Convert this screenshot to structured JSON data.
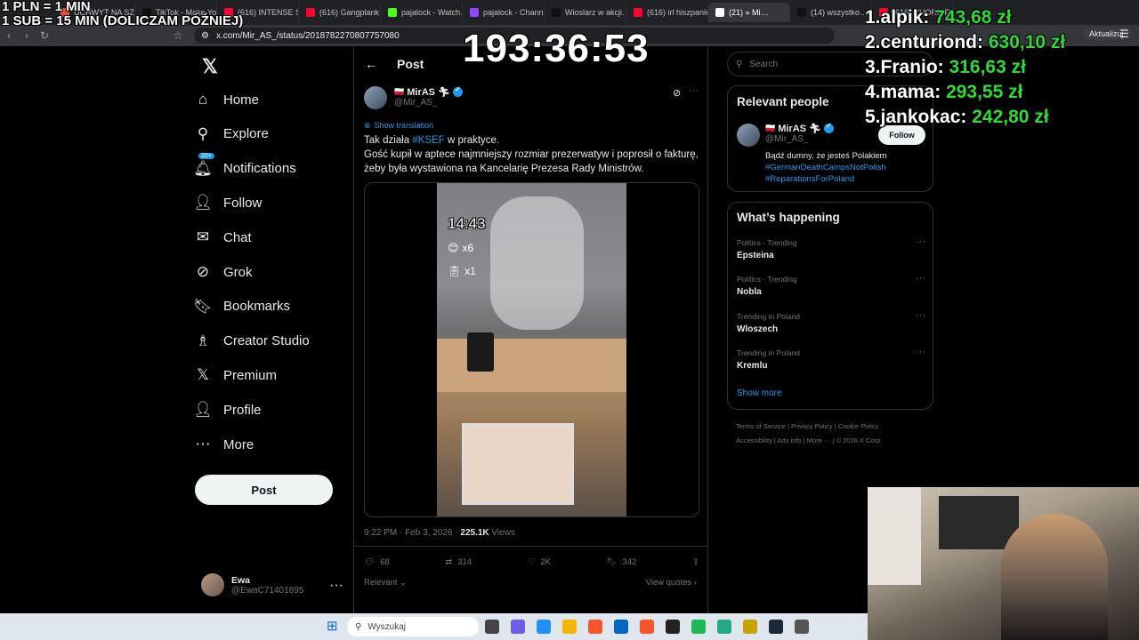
{
  "overlay": {
    "pln_line1": "1 PLN = 1 MIN",
    "pln_line2": "1 SUB = 15 MIN (DOLICZAM PÓŹNIEJ)",
    "timer": "193:36:53",
    "leaderboard": [
      {
        "rank": "1.",
        "name": "alpik:",
        "amount": "743,68 zł"
      },
      {
        "rank": "2.",
        "name": "centuriond:",
        "amount": "630,10 zł"
      },
      {
        "rank": "3.",
        "name": "Franio:",
        "amount": "316,63 zł"
      },
      {
        "rank": "4.",
        "name": "mama:",
        "amount": "293,55 zł"
      },
      {
        "rank": "5.",
        "name": "jankokac:",
        "amount": "242,80 zł"
      }
    ]
  },
  "browser": {
    "tabs": [
      {
        "label": "UCHWYT NA SZ…",
        "color": "#e44d26"
      },
      {
        "label": "TikTok - Make Yo…",
        "color": "#111111"
      },
      {
        "label": "(616) INTENSE S…",
        "color": "#ff0033"
      },
      {
        "label": "(616) Gangplank…",
        "color": "#ff0033"
      },
      {
        "label": "pajalock - Watch…",
        "color": "#53fc18"
      },
      {
        "label": "pajalock - Chann…",
        "color": "#9146ff"
      },
      {
        "label": "Wioslarz w akcji…",
        "color": "#111111"
      },
      {
        "label": "(616) irl hiszpanie…",
        "color": "#ff0033"
      },
      {
        "label": "(21) » Mi…",
        "color": "#ffffff",
        "active": true
      },
      {
        "label": "(14) wszystko…",
        "color": "#111111"
      },
      {
        "label": "(616) CHORE P…",
        "color": "#ff0033"
      }
    ],
    "url": "x.com/Mir_AS_/status/2018782270807757080",
    "update_button": "Aktualizuj"
  },
  "nav": {
    "items": [
      {
        "label": "Home",
        "icon": "home-icon",
        "glyph": "⌂"
      },
      {
        "label": "Explore",
        "icon": "search-icon",
        "glyph": "⚲"
      },
      {
        "label": "Notifications",
        "icon": "bell-icon",
        "glyph": "🔔︎"
      },
      {
        "label": "Follow",
        "icon": "add-person-icon",
        "glyph": "👤︎"
      },
      {
        "label": "Chat",
        "icon": "mail-icon",
        "glyph": "✉"
      },
      {
        "label": "Grok",
        "icon": "grok-icon",
        "glyph": "⊘"
      },
      {
        "label": "Bookmarks",
        "icon": "bookmark-icon",
        "glyph": "🔖︎"
      },
      {
        "label": "Creator Studio",
        "icon": "creator-studio-icon",
        "glyph": "♗"
      },
      {
        "label": "Premium",
        "icon": "x-logo-icon",
        "glyph": "𝕏"
      },
      {
        "label": "Profile",
        "icon": "profile-icon",
        "glyph": "👤︎"
      },
      {
        "label": "More",
        "icon": "more-circle-icon",
        "glyph": "⋯"
      }
    ],
    "notifications_badge": "20+",
    "post_button": "Post",
    "user": {
      "name": "Ewa",
      "handle": "@EwaC71401895"
    }
  },
  "post": {
    "header": "Post",
    "author_name": "MirAS",
    "author_handle": "@Mir_AS_",
    "show_translation": "Show translation",
    "text_before_tag": "Tak działa ",
    "hashtag": "#KSEF",
    "text_after_tag": " w praktyce.",
    "text_line2": "Gość kupił w aptece najmniejszy rozmiar prezerwatyw i poprosił o fakturę, żeby była wystawiona na Kancelarię Prezesa Rady Ministrów.",
    "video_overlay": {
      "time": "14:43",
      "count1": "x6",
      "count2": "x1"
    },
    "timestamp": "9:22 PM · Feb 3, 2026 · ",
    "views_count": "225.1K",
    "views_label": " Views",
    "replies": "68",
    "reposts": "314",
    "likes": "2K",
    "bookmarks": "342",
    "relevant": "Relevant",
    "view_quotes": "View quotes"
  },
  "right": {
    "search_placeholder": "Search",
    "relevant_people": {
      "title": "Relevant people",
      "name": "MirAS",
      "handle": "@Mir_AS_",
      "follow": "Follow",
      "bio": "Bądź dumny, że jesteś Polakiem",
      "tag1": "#GermanDeathCampsNotPolish",
      "tag2": "#ReparationsForPoland"
    },
    "happening": {
      "title": "What’s happening",
      "trends": [
        {
          "context": "Politics · Trending",
          "title": "Epsteina"
        },
        {
          "context": "Politics · Trending",
          "title": "Nobla"
        },
        {
          "context": "Trending in Poland",
          "title": "Wloszech"
        },
        {
          "context": "Trending in Poland",
          "title": "Kremlu"
        }
      ],
      "show_more": "Show more"
    },
    "footer": {
      "line1": [
        "Terms of Service",
        "Privacy Policy",
        "Cookie Policy"
      ],
      "line2": [
        "Accessibility",
        "Ads info",
        "More ···",
        "© 2026 X Corp."
      ]
    }
  },
  "taskbar": {
    "search_placeholder": "Wyszukaj"
  }
}
